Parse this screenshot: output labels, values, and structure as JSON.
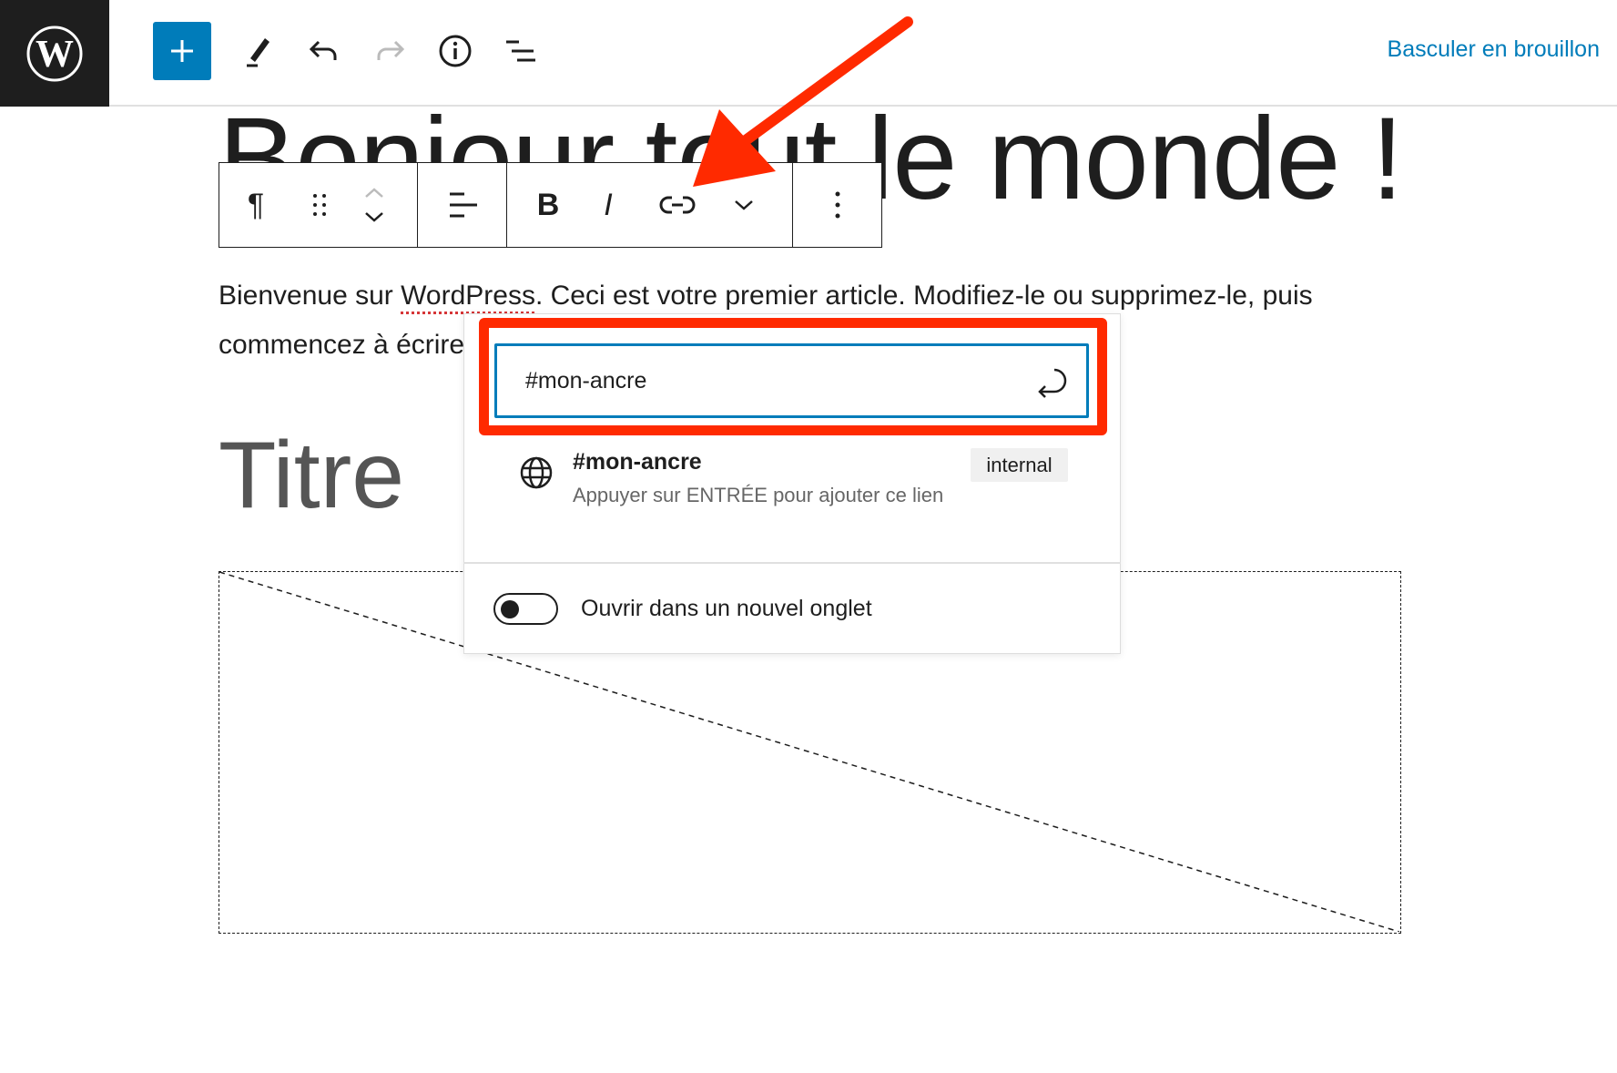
{
  "topbar": {
    "logo": "WordPress",
    "icons": [
      "plus-icon",
      "pencil-icon",
      "undo-icon",
      "redo-icon",
      "info-icon",
      "list-view-icon"
    ],
    "draft_label": "Basculer en brouillon",
    "accent": "#007cba"
  },
  "post": {
    "title": "Bonjour tout le monde !",
    "paragraph_pre": "Bienvenue sur ",
    "paragraph_word": "WordPress",
    "paragraph_post": ". Ceci est votre premier article. Modifiez-le ou supprimez-le, puis commencez à écrire !",
    "heading": "Titre"
  },
  "block_toolbar": {
    "paragraph": "¶",
    "bold": "B",
    "italic": "I"
  },
  "link_popover": {
    "input_value": "#mon-ancre",
    "suggestion_title": "#mon-ancre",
    "suggestion_info": "Appuyer sur ENTRÉE pour ajouter ce lien",
    "suggestion_type": "internal",
    "new_tab_label": "Ouvrir dans un nouvel onglet",
    "new_tab_on": false
  },
  "annotation_color": "#ff2a00"
}
